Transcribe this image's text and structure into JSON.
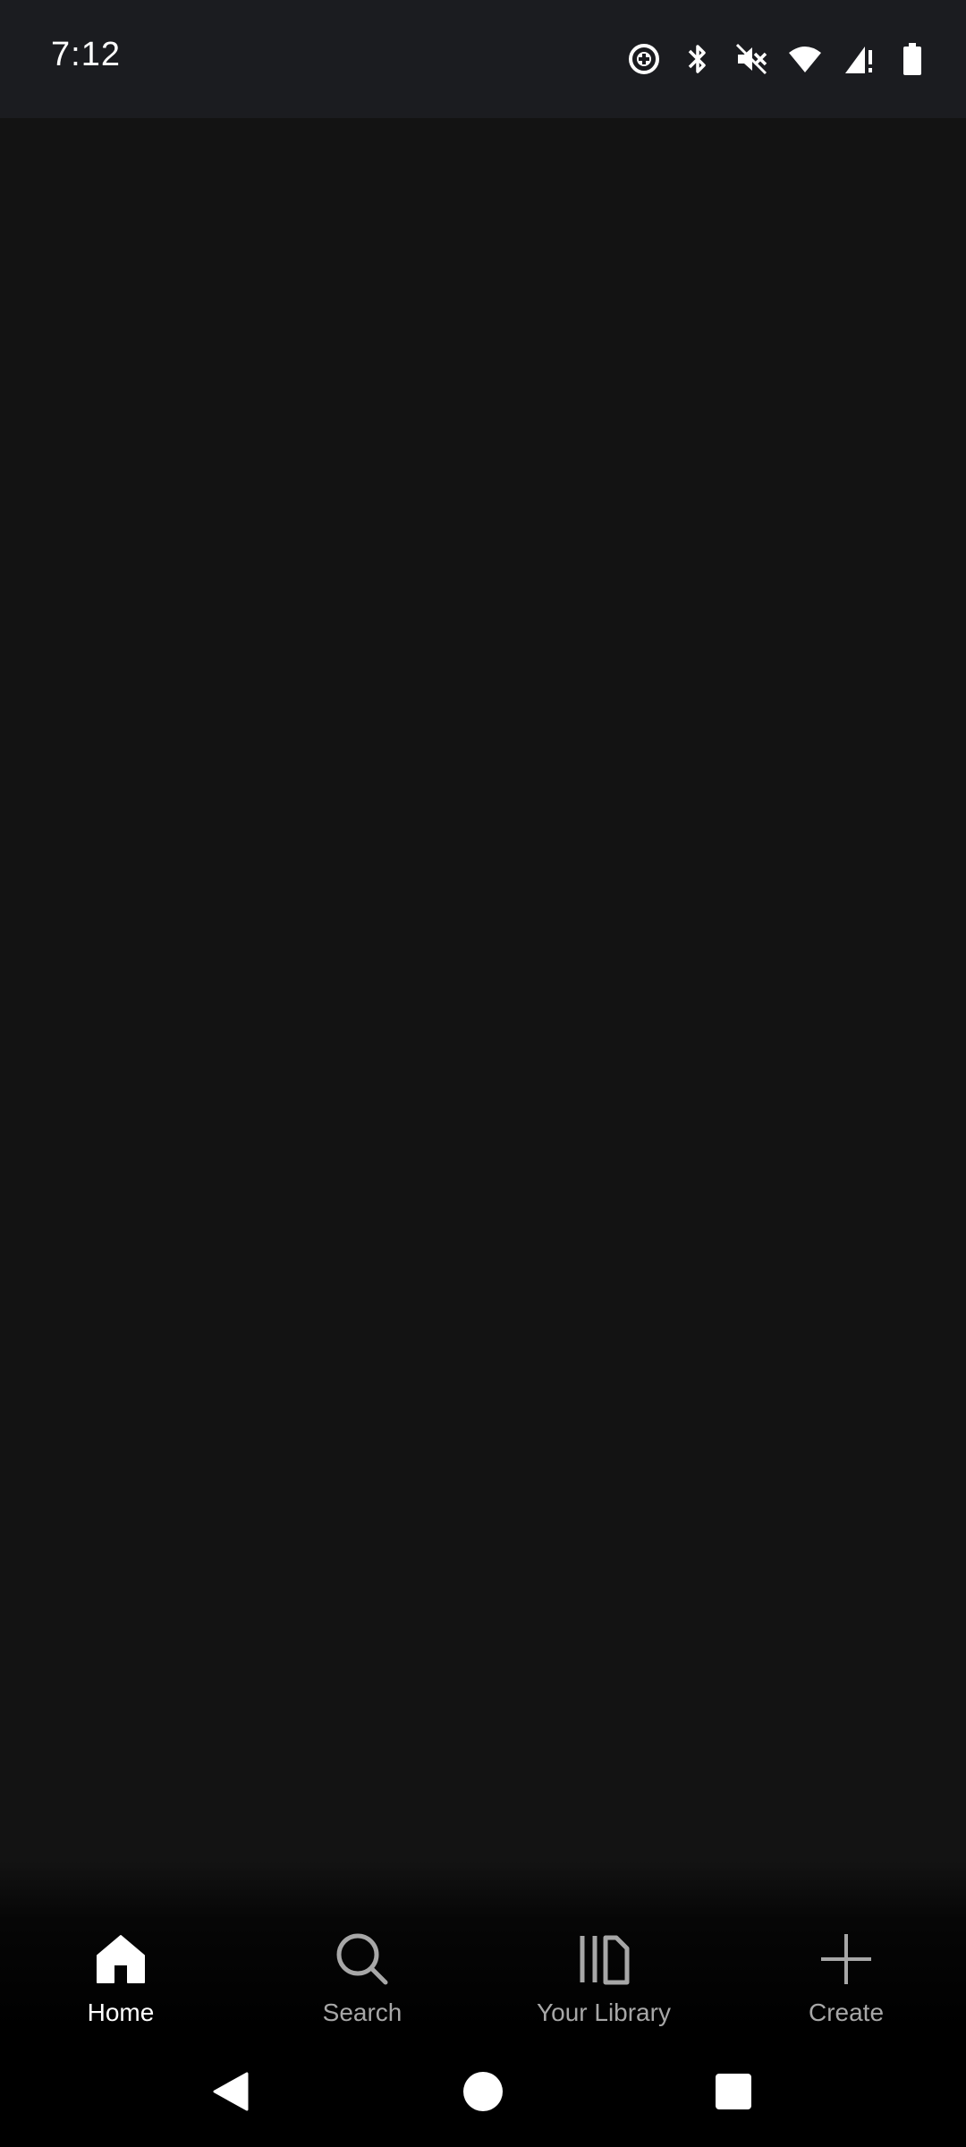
{
  "status_bar": {
    "time": "7:12",
    "icons": [
      "sync-icon",
      "bluetooth-icon",
      "mute-icon",
      "wifi-icon",
      "signal-icon",
      "battery-icon"
    ]
  },
  "bottom_nav": {
    "items": [
      {
        "label": "Home",
        "icon": "home-icon",
        "active": true
      },
      {
        "label": "Search",
        "icon": "search-icon",
        "active": false
      },
      {
        "label": "Your Library",
        "icon": "library-icon",
        "active": false
      },
      {
        "label": "Create",
        "icon": "plus-icon",
        "active": false
      }
    ]
  },
  "system_nav": {
    "buttons": [
      "back-icon",
      "home-circle-icon",
      "recents-icon"
    ]
  },
  "colors": {
    "background": "#131313",
    "status_bar": "#1b1c20",
    "active_label": "#ffffff",
    "inactive_label": "#a7a7a7"
  }
}
